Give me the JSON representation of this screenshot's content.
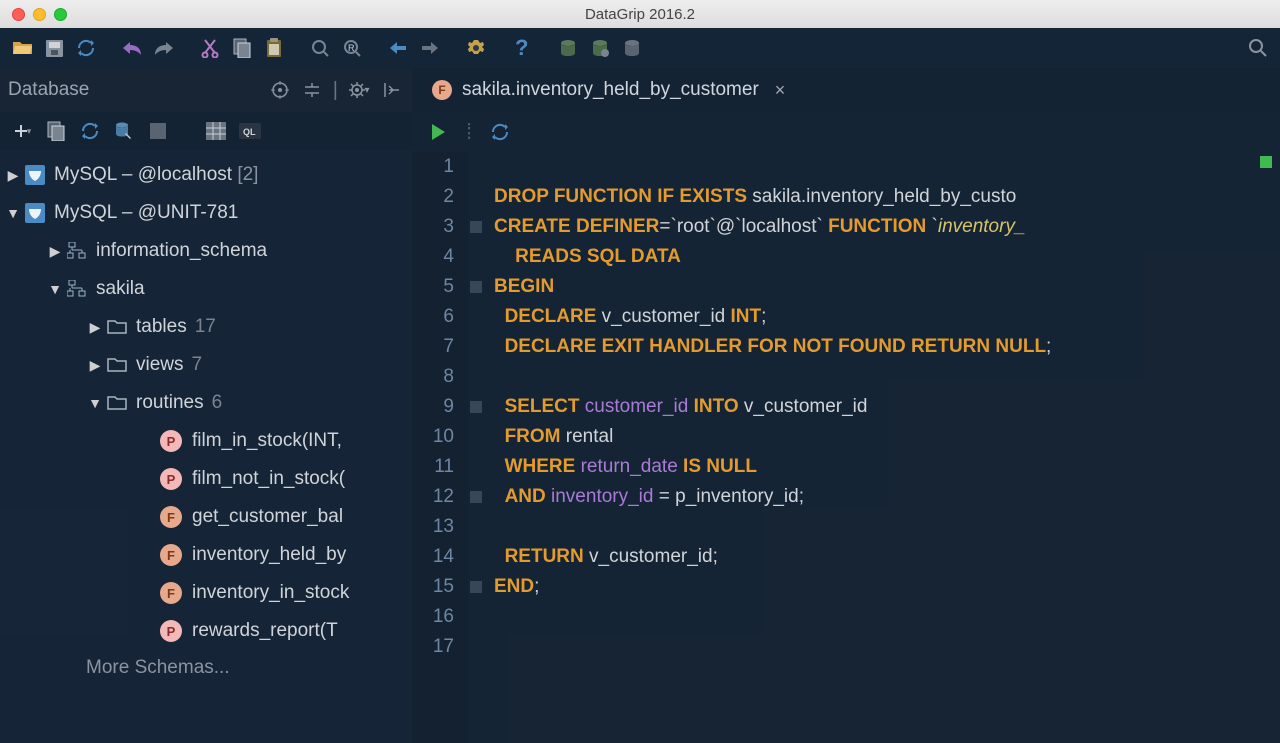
{
  "window": {
    "title": "DataGrip 2016.2"
  },
  "sidebar": {
    "title": "Database",
    "connections": [
      {
        "label": "MySQL – @localhost",
        "suffix": "[2]",
        "expanded": false
      },
      {
        "label": "MySQL – @UNIT-781",
        "suffix": "",
        "expanded": true
      }
    ],
    "schemas": [
      {
        "name": "information_schema",
        "expanded": false
      },
      {
        "name": "sakila",
        "expanded": true
      }
    ],
    "folders": {
      "tables": {
        "label": "tables",
        "count": "17"
      },
      "views": {
        "label": "views",
        "count": "7"
      },
      "routines": {
        "label": "routines",
        "count": "6"
      }
    },
    "routines": [
      {
        "badge": "P",
        "label": "film_in_stock(INT,"
      },
      {
        "badge": "P",
        "label": "film_not_in_stock("
      },
      {
        "badge": "F",
        "label": "get_customer_bal"
      },
      {
        "badge": "F",
        "label": "inventory_held_by"
      },
      {
        "badge": "F",
        "label": "inventory_in_stock"
      },
      {
        "badge": "P",
        "label": "rewards_report(T"
      }
    ],
    "more": "More Schemas..."
  },
  "tab": {
    "badge": "F",
    "label": "sakila.inventory_held_by_customer"
  },
  "editor": {
    "line_count": 17,
    "code_lines": [
      "",
      "<kw>DROP FUNCTION IF EXISTS</kw> sakila.inventory_held_by_custo",
      "<kw>CREATE DEFINER</kw>=`root`@`localhost` <kw>FUNCTION</kw> `<fn>inventory_</fn>",
      "    <kw>READS SQL DATA</kw>",
      "<kw>BEGIN</kw>",
      "  <kw>DECLARE</kw> v_customer_id <kw>INT</kw>;",
      "  <kw>DECLARE EXIT HANDLER FOR NOT FOUND RETURN NULL</kw>;",
      "",
      "  <kw>SELECT</kw> <id>customer_id</id> <kw>INTO</kw> v_customer_id",
      "  <kw>FROM</kw> rental",
      "  <kw>WHERE</kw> <id>return_date</id> <kw>IS NULL</kw>",
      "  <kw>AND</kw> <id>inventory_id</id> = p_inventory_id;",
      "",
      "  <kw>RETURN</kw> v_customer_id;",
      "<kw>END</kw>;",
      "",
      ""
    ]
  }
}
